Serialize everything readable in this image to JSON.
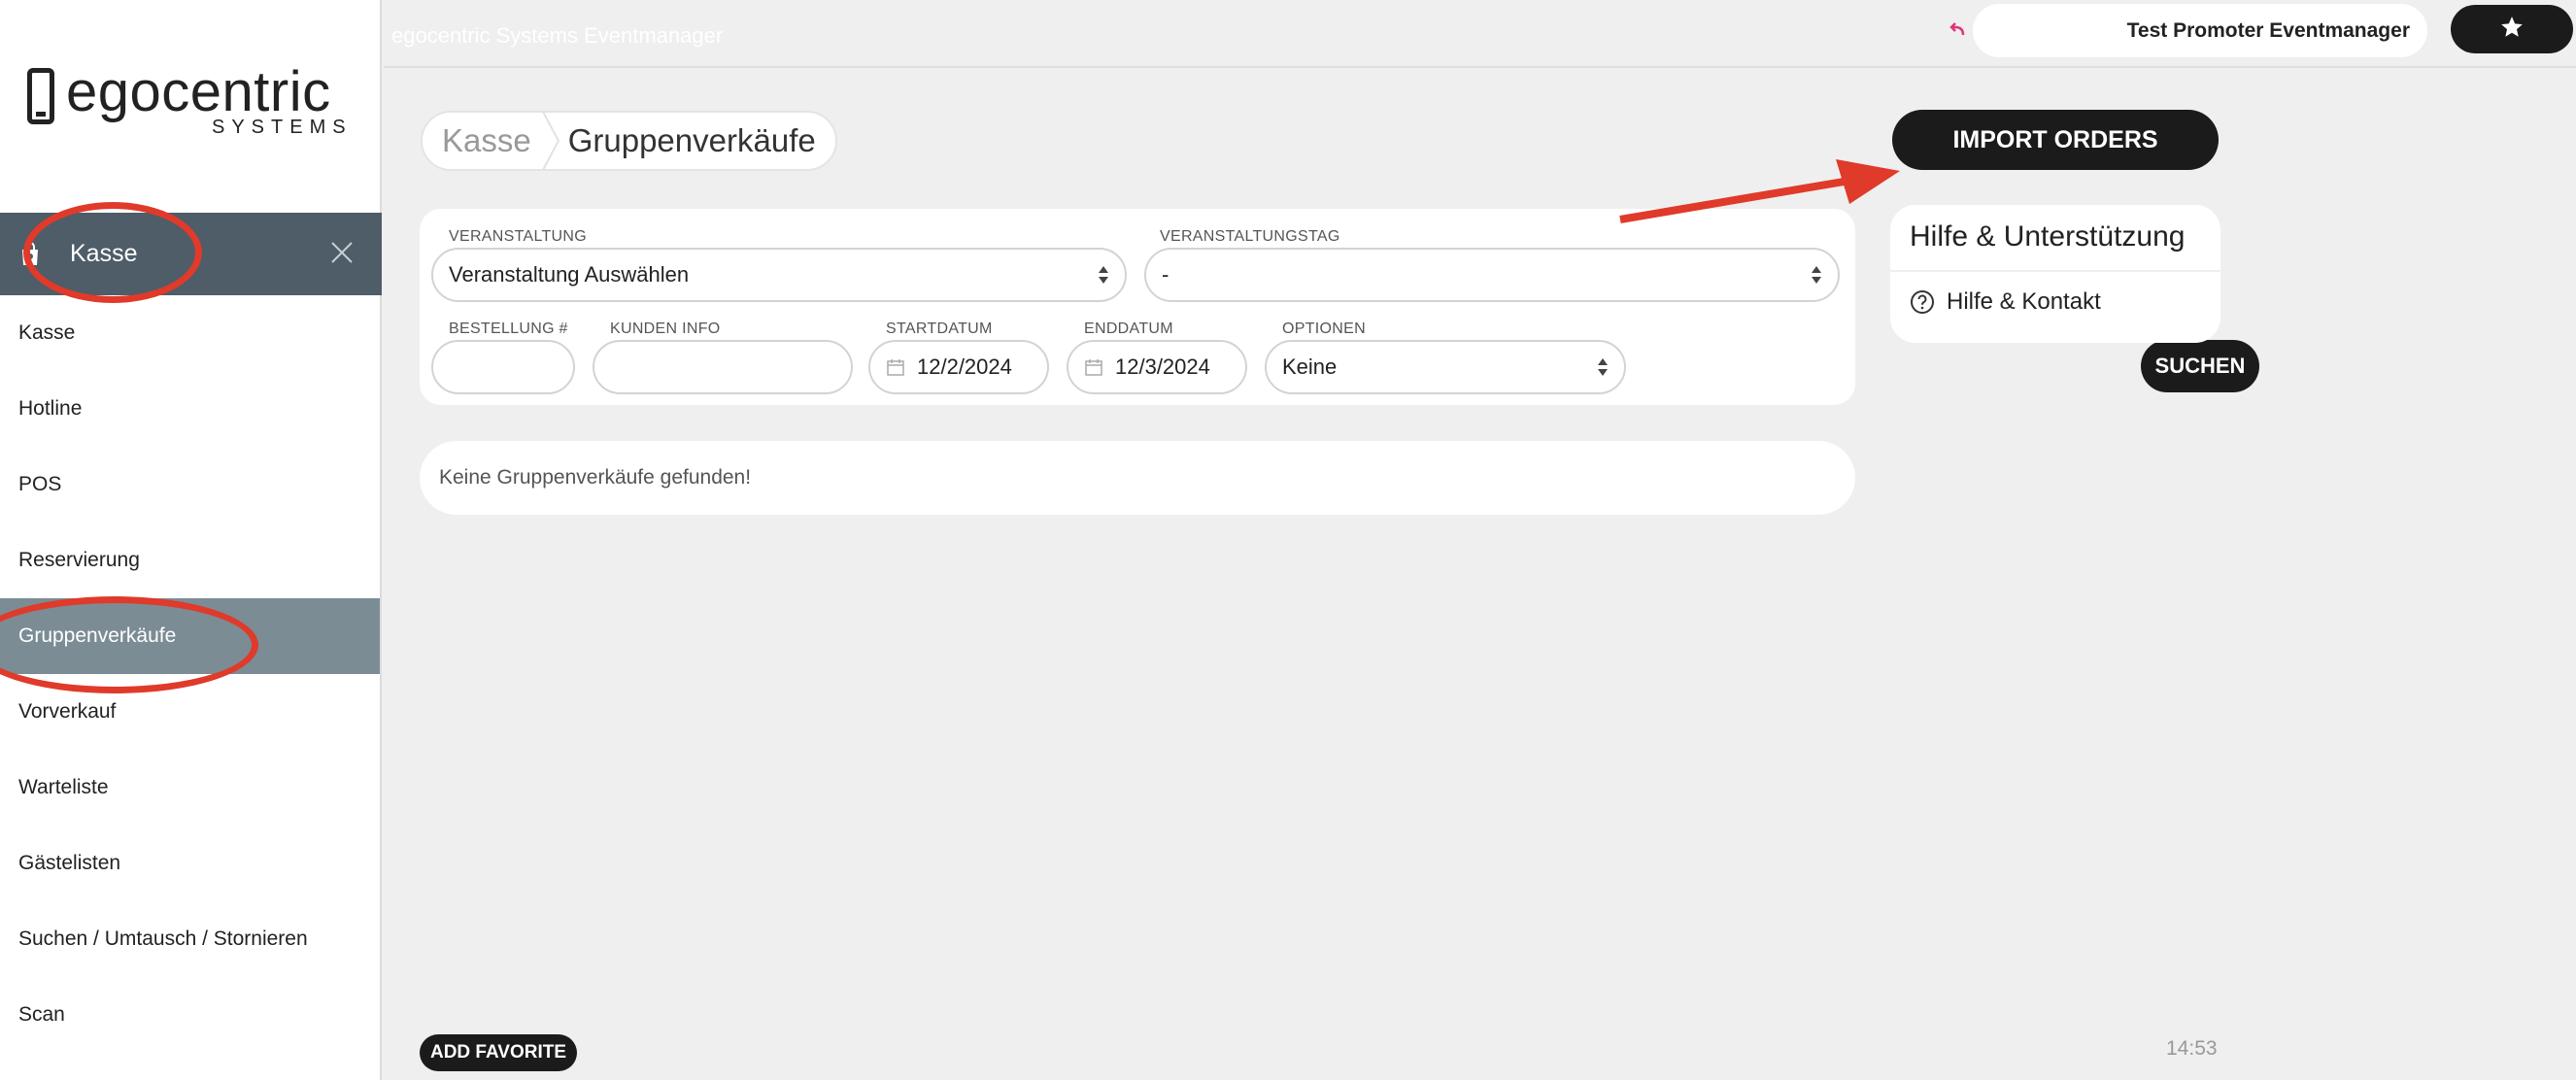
{
  "app": {
    "title": "egocentric Systems Eventmanager"
  },
  "brand": {
    "name": "egocentric",
    "tagline": "SYSTEMS"
  },
  "account": {
    "name": "Test Promoter Eventmanager"
  },
  "sidebar": {
    "section_title": "Kasse",
    "items": [
      {
        "label": "Kasse"
      },
      {
        "label": "Hotline"
      },
      {
        "label": "POS"
      },
      {
        "label": "Reservierung"
      },
      {
        "label": "Gruppenverkäufe",
        "active": true
      },
      {
        "label": "Vorverkauf"
      },
      {
        "label": "Warteliste"
      },
      {
        "label": "Gästelisten"
      },
      {
        "label": "Suchen / Umtausch / Stornieren"
      },
      {
        "label": "Scan"
      }
    ]
  },
  "breadcrumb": {
    "parent": "Kasse",
    "current": "Gruppenverkäufe"
  },
  "filters": {
    "veranstaltung": {
      "label": "VERANSTALTUNG",
      "value": "Veranstaltung Auswählen"
    },
    "veranstaltungstag": {
      "label": "VERANSTALTUNGSTAG",
      "value": "-"
    },
    "bestellung": {
      "label": "BESTELLUNG #",
      "value": ""
    },
    "kunden_info": {
      "label": "KUNDEN INFO",
      "value": ""
    },
    "startdatum": {
      "label": "STARTDATUM",
      "value": "12/2/2024"
    },
    "enddatum": {
      "label": "ENDDATUM",
      "value": "12/3/2024"
    },
    "optionen": {
      "label": "OPTIONEN",
      "value": "Keine"
    },
    "search_label": "SUCHEN"
  },
  "results": {
    "empty_message": "Keine Gruppenverkäufe gefunden!"
  },
  "actions": {
    "import_label": "IMPORT ORDERS",
    "add_favorite_label": "ADD FAVORITE"
  },
  "help": {
    "title": "Hilfe & Unterstützung",
    "link": "Hilfe & Kontakt"
  },
  "footer": {
    "time": "14:53"
  },
  "colors": {
    "annotation": "#e03a2a",
    "sidebar_header": "#4e5d67",
    "sidebar_active": "#7b8c95",
    "button_dark": "#1b1b1b"
  }
}
